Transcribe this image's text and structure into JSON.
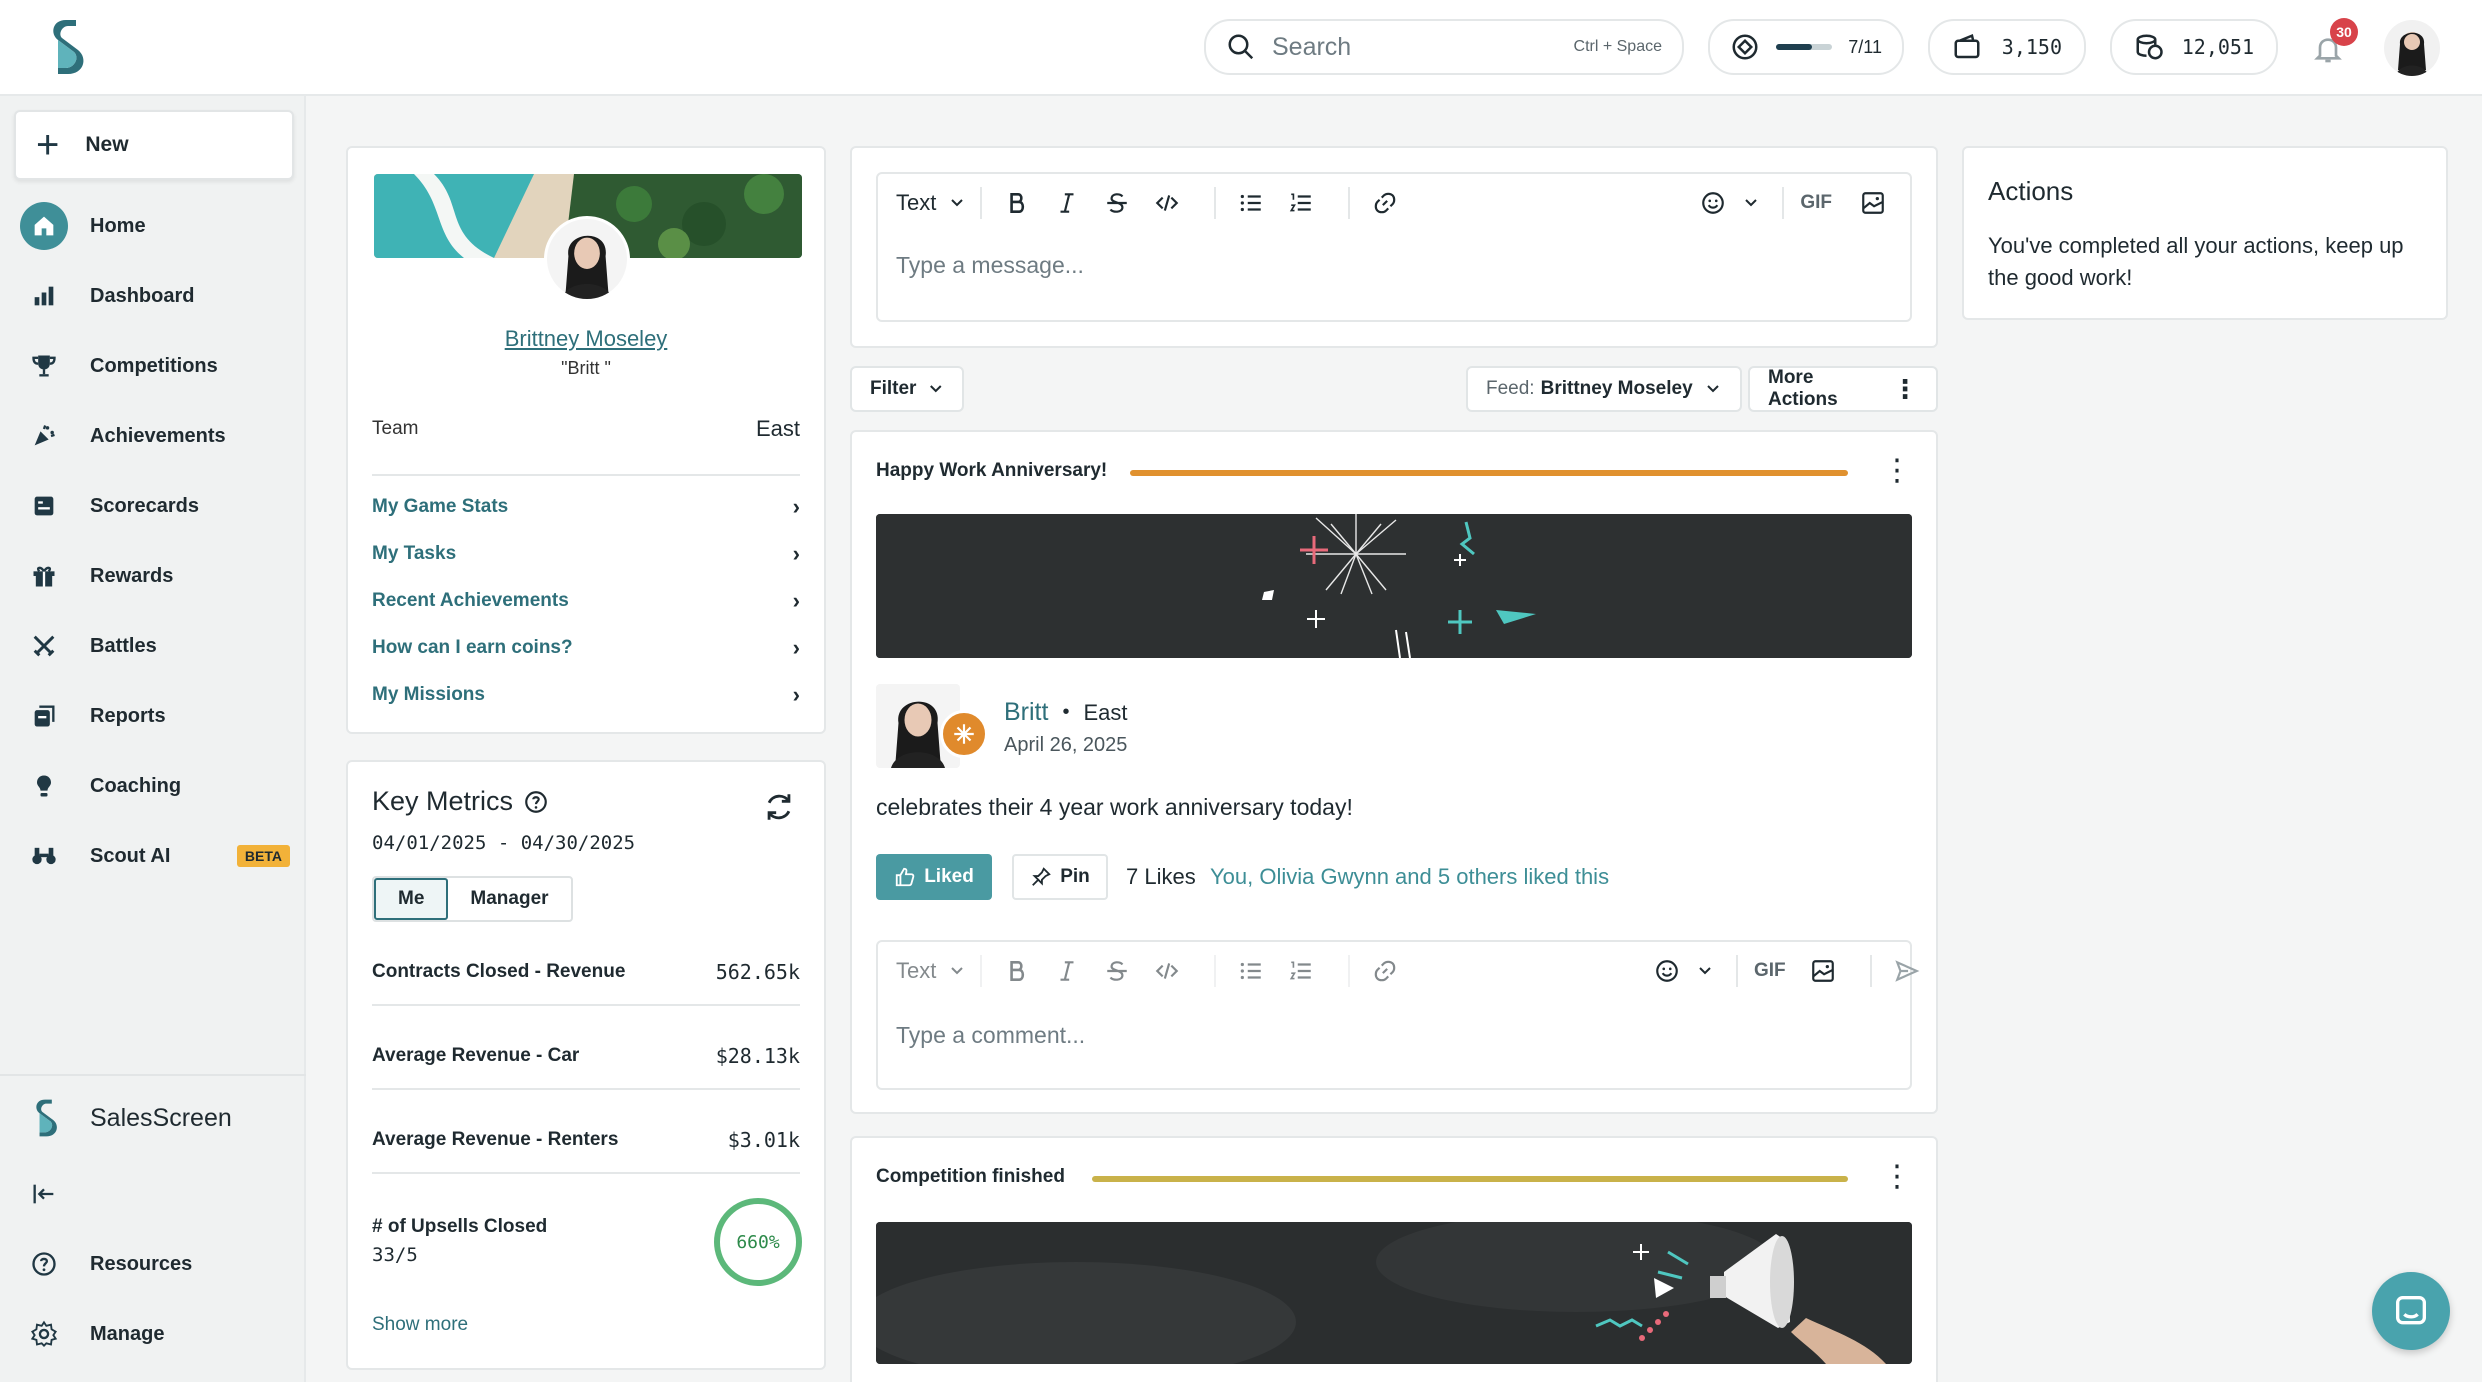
{
  "topbar": {
    "search_placeholder": "Search",
    "search_shortcut": "Ctrl + Space",
    "progress_label": "7/11",
    "progress_fraction": 0.64,
    "wallet": "3,150",
    "coins": "12,051",
    "notifications": "30"
  },
  "sidebar": {
    "new_label": "New",
    "items": [
      {
        "label": "Home",
        "icon": "home-icon"
      },
      {
        "label": "Dashboard",
        "icon": "bar-chart-icon"
      },
      {
        "label": "Competitions",
        "icon": "trophy-icon"
      },
      {
        "label": "Achievements",
        "icon": "party-popper-icon"
      },
      {
        "label": "Scorecards",
        "icon": "scorecard-icon"
      },
      {
        "label": "Rewards",
        "icon": "gift-icon"
      },
      {
        "label": "Battles",
        "icon": "crossed-swords-icon"
      },
      {
        "label": "Reports",
        "icon": "reports-icon"
      },
      {
        "label": "Coaching",
        "icon": "lightbulb-icon"
      },
      {
        "label": "Scout AI",
        "icon": "binoculars-icon",
        "badge": "BETA"
      }
    ],
    "brand": "SalesScreen",
    "bottom": [
      {
        "label": "Resources",
        "icon": "help-icon"
      },
      {
        "label": "Manage",
        "icon": "gear-icon"
      }
    ]
  },
  "profile": {
    "name": "Brittney Moseley",
    "nickname": "\"Britt \"",
    "team_label": "Team",
    "team_value": "East",
    "links": [
      "My Game Stats",
      "My Tasks",
      "Recent Achievements",
      "How can I earn coins?",
      "My Missions"
    ]
  },
  "metrics": {
    "title": "Key Metrics",
    "range": "04/01/2025 - 04/30/2025",
    "toggle": [
      "Me",
      "Manager"
    ],
    "rows": [
      {
        "label": "Contracts Closed - Revenue",
        "value": "562.65k"
      },
      {
        "label": "Average Revenue - Car",
        "value": "$28.13k"
      },
      {
        "label": "Average Revenue - Renters",
        "value": "$3.01k"
      }
    ],
    "upsells_label": "# of Upsells Closed",
    "upsells_sub": "33/5",
    "upsells_pct": "660%",
    "show_more": "Show more"
  },
  "composer": {
    "text_style": "Text",
    "placeholder": "Type a message...",
    "gif": "GIF"
  },
  "feed": {
    "filter": "Filter",
    "feed_prefix": "Feed:",
    "feed_name": "Brittney Moseley",
    "more_actions": "More Actions"
  },
  "post1": {
    "title": "Happy Work Anniversary!",
    "author": "Britt",
    "separator": "•",
    "team": "East",
    "date": "April 26, 2025",
    "body": "celebrates their 4 year work anniversary today!",
    "liked": "Liked",
    "pin": "Pin",
    "likes": "7 Likes",
    "liked_by": "You, Olivia Gwynn and 5 others liked this",
    "comment_placeholder": "Type a comment...",
    "comment_style": "Text",
    "gif": "GIF",
    "line_color": "#e0912f"
  },
  "post2": {
    "title": "Competition finished",
    "line_color": "#c9b24a"
  },
  "actions": {
    "title": "Actions",
    "body": "You've completed all your actions, keep up the good work!"
  }
}
